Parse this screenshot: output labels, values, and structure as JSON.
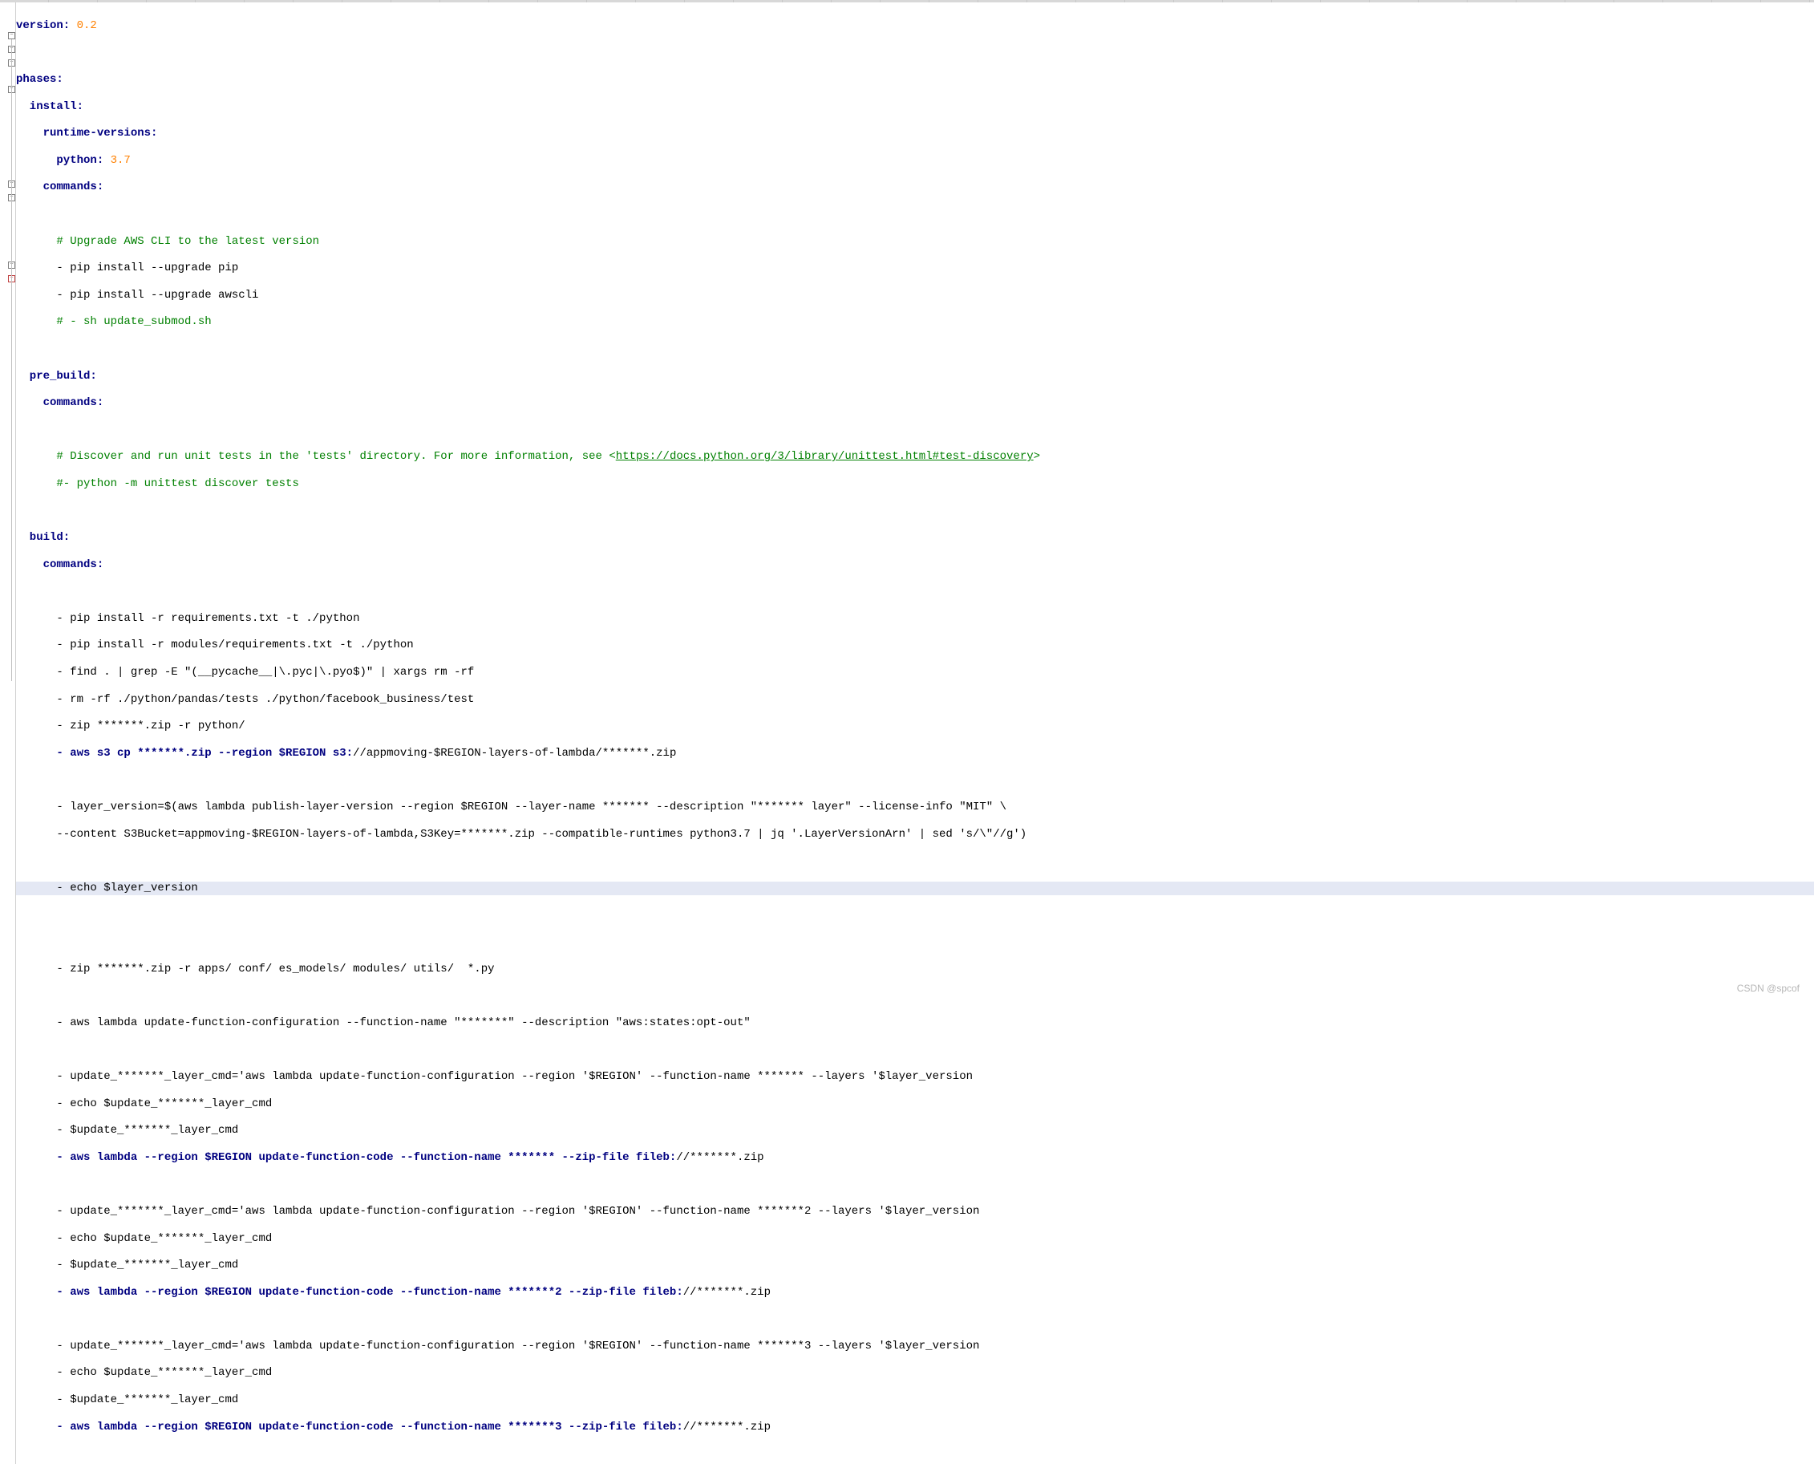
{
  "watermark": "CSDN @spcof",
  "yaml": {
    "version_key": "version:",
    "version_val": " 0.2",
    "phases_key": "phases:",
    "install_key": "  install:",
    "runtime_versions_key": "    runtime-versions:",
    "python_key": "      python:",
    "python_val": " 3.7",
    "install_commands_key": "    commands:",
    "comment_upgrade": "      # Upgrade AWS CLI to the latest version",
    "cmd_pip_pip": "      - pip install --upgrade pip",
    "cmd_pip_awscli": "      - pip install --upgrade awscli",
    "comment_sh": "      # - sh update_submod.sh",
    "pre_build_key": "  pre_build:",
    "pre_build_commands_key": "    commands:",
    "comment_discover_pre": "      # Discover and run unit tests in the 'tests' directory. For more information, see <",
    "comment_discover_link": "https://docs.python.org/3/library/unittest.html#test-discovery",
    "comment_discover_post": ">",
    "comment_unittest": "      #- python -m unittest discover tests",
    "build_key": "  build:",
    "build_commands_key": "    commands:",
    "cmd_pip_req": "      - pip install -r requirements.txt -t ./python",
    "cmd_pip_modreq": "      - pip install -r modules/requirements.txt -t ./python",
    "cmd_find_grep": "      - find . | grep -E \"(__pycache__|\\.pyc|\\.pyo$)\" | xargs rm -rf",
    "cmd_rm_tests": "      - rm -rf ./python/pandas/tests ./python/facebook_business/test",
    "cmd_zip_python": "      - zip *******.zip -r python/",
    "cmd_s3cp_bold": "      - aws s3 cp *******.zip --region $REGION s3:",
    "cmd_s3cp_rest": "//appmoving-$REGION-layers-of-lambda/*******.zip",
    "cmd_layerver_l1": "      - layer_version=$(aws lambda publish-layer-version --region $REGION --layer-name ******* --description \"******* layer\" --license-info \"MIT\" \\",
    "cmd_layerver_l2": "      --content S3Bucket=appmoving-$REGION-layers-of-lambda,S3Key=*******.zip --compatible-runtimes python3.7 | jq '.LayerVersionArn' | sed 's/\\\"//g')",
    "cmd_echo_layer": "      - echo $layer_version",
    "cmd_zip_apps": "      - zip *******.zip -r apps/ conf/ es_models/ modules/ utils/  *.py",
    "cmd_updfn_optout": "      - aws lambda update-function-configuration --function-name \"*******\" --description \"aws:states:opt-out\"",
    "cmd_upd1_set": "      - update_*******_layer_cmd='aws lambda update-function-configuration --region '$REGION' --function-name ******* --layers '$layer_version",
    "cmd_upd1_echo": "      - echo $update_*******_layer_cmd",
    "cmd_upd1_run": "      - $update_*******_layer_cmd",
    "cmd_upd1_bold": "      - aws lambda --region $REGION update-function-code --function-name ******* --zip-file fileb:",
    "cmd_upd1_rest": "//*******.zip",
    "cmd_upd2_set": "      - update_*******_layer_cmd='aws lambda update-function-configuration --region '$REGION' --function-name *******2 --layers '$layer_version",
    "cmd_upd2_echo": "      - echo $update_*******_layer_cmd",
    "cmd_upd2_run": "      - $update_*******_layer_cmd",
    "cmd_upd2_bold": "      - aws lambda --region $REGION update-function-code --function-name *******2 --zip-file fileb:",
    "cmd_upd2_rest": "//*******.zip",
    "cmd_upd3_set": "      - update_*******_layer_cmd='aws lambda update-function-configuration --region '$REGION' --function-name *******3 --layers '$layer_version",
    "cmd_upd3_echo": "      - echo $update_*******_layer_cmd",
    "cmd_upd3_run": "      - $update_*******_layer_cmd",
    "cmd_upd3_bold": "      - aws lambda --region $REGION update-function-code --function-name *******3 --zip-file fileb:",
    "cmd_upd3_rest": "//*******.zip"
  },
  "fold_markers": [
    {
      "line": 3,
      "symbol": "−"
    },
    {
      "line": 4,
      "symbol": "−"
    },
    {
      "line": 5,
      "symbol": "−"
    },
    {
      "line": 7,
      "symbol": "−"
    },
    {
      "line": 14,
      "symbol": "−"
    },
    {
      "line": 15,
      "symbol": "−"
    },
    {
      "line": 20,
      "symbol": "−"
    },
    {
      "line": 21,
      "symbol": "−"
    }
  ]
}
